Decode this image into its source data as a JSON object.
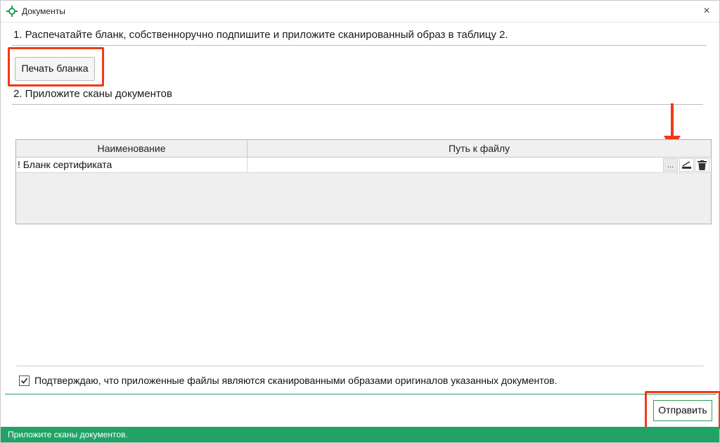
{
  "window": {
    "title": "Документы",
    "close_icon": "×"
  },
  "step1": {
    "text": "1. Распечатайте бланк, собственноручно подпишите и приложите сканированный образ в таблицу 2."
  },
  "print_button": {
    "label": "Печать бланка"
  },
  "step2": {
    "text": "2. Приложите сканы документов"
  },
  "table": {
    "columns": [
      "Наименование",
      "Путь к файлу"
    ],
    "rows": [
      {
        "name": "! Бланк сертификата",
        "path": ""
      }
    ],
    "row_buttons": {
      "browse": "...",
      "scan_icon": "scanner-icon",
      "delete_icon": "trash-icon"
    }
  },
  "confirm": {
    "checked": true,
    "label": "Подтверждаю, что приложенные файлы являются сканированными образами оригиналов указанных документов."
  },
  "send_button": {
    "label": "Отправить"
  },
  "status_bar": {
    "text": "Приложите сканы документов."
  },
  "colors": {
    "accent_green": "#21a366",
    "highlight_red": "#f03a17"
  }
}
